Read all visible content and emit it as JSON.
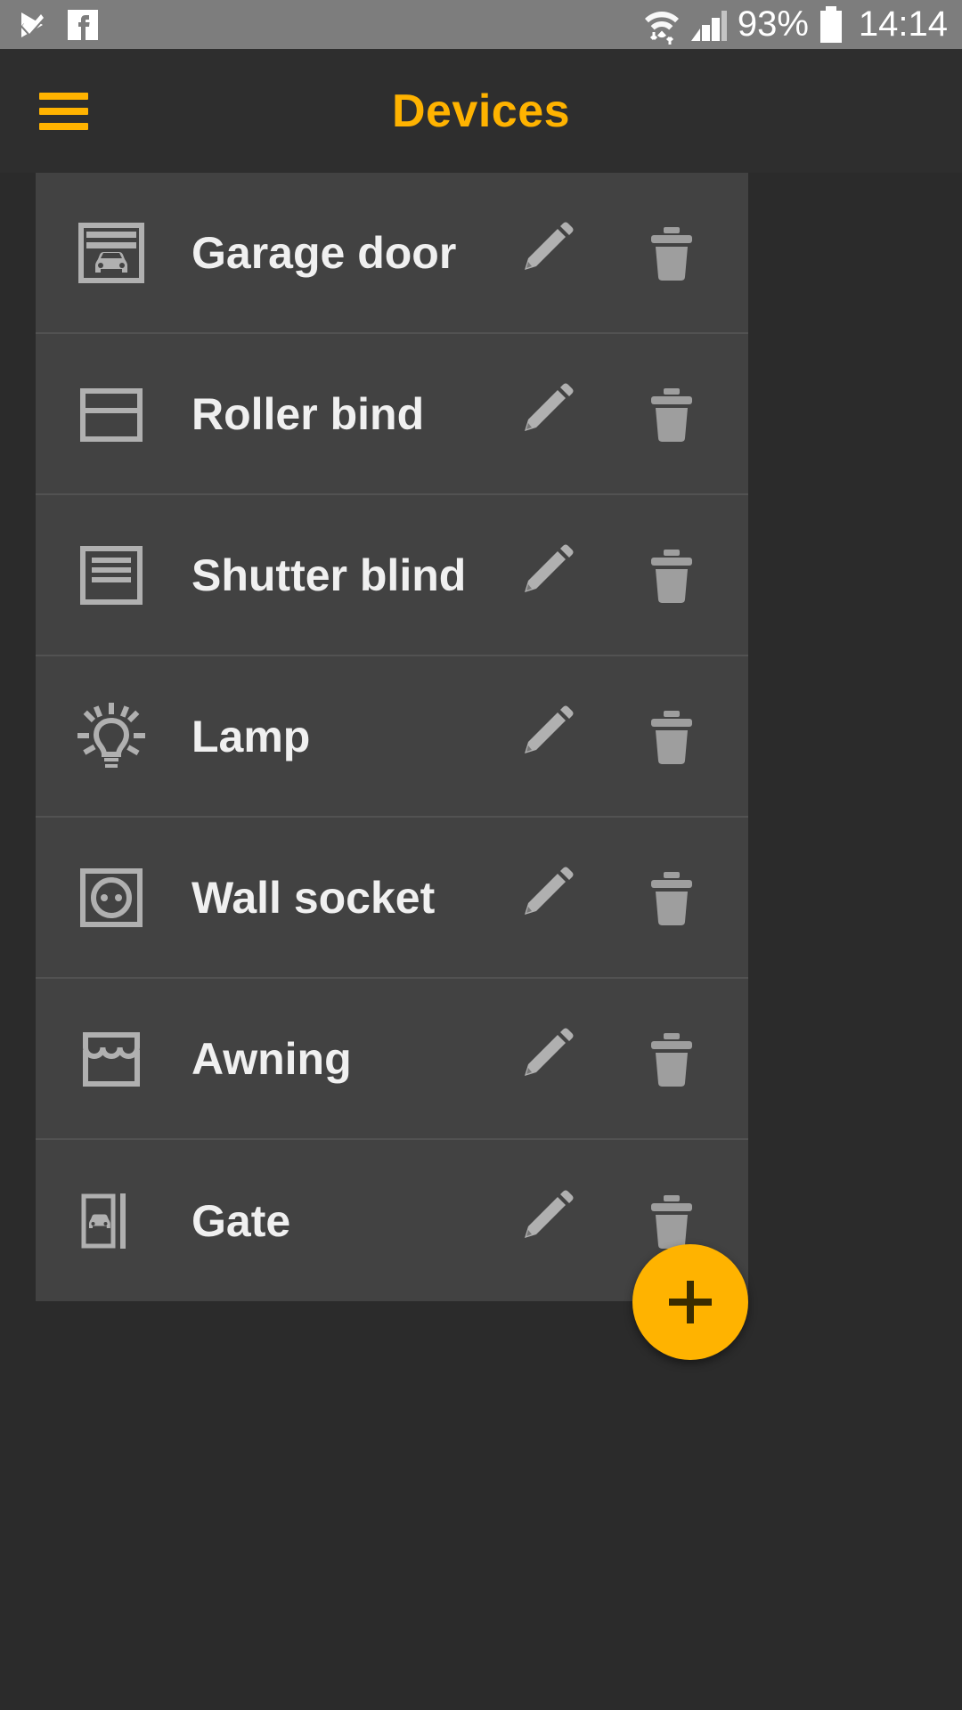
{
  "status_bar": {
    "left_icons": [
      "play-check-icon",
      "facebook-icon"
    ],
    "wifi_icon": "wifi-data-icon",
    "signal_icon": "signal-bars-icon",
    "battery_percent": "93%",
    "battery_icon": "battery-full-icon",
    "clock": "14:14"
  },
  "header": {
    "menu_icon": "hamburger-menu-icon",
    "title": "Devices",
    "accent_color": "#FFB300"
  },
  "devices": [
    {
      "name": "Garage door",
      "icon": "garage-door-icon",
      "edit_label": "edit-icon",
      "delete_label": "trash-icon"
    },
    {
      "name": "Roller bind",
      "icon": "roller-blind-icon",
      "edit_label": "edit-icon",
      "delete_label": "trash-icon"
    },
    {
      "name": "Shutter blind",
      "icon": "shutter-blind-icon",
      "edit_label": "edit-icon",
      "delete_label": "trash-icon"
    },
    {
      "name": "Lamp",
      "icon": "lamp-icon",
      "edit_label": "edit-icon",
      "delete_label": "trash-icon"
    },
    {
      "name": "Wall socket",
      "icon": "wall-socket-icon",
      "edit_label": "edit-icon",
      "delete_label": "trash-icon"
    },
    {
      "name": "Awning",
      "icon": "awning-icon",
      "edit_label": "edit-icon",
      "delete_label": "trash-icon"
    },
    {
      "name": "Gate",
      "icon": "gate-icon",
      "edit_label": "edit-icon",
      "delete_label": "trash-icon"
    }
  ],
  "fab": {
    "icon": "plus-icon",
    "color": "#FFB300"
  }
}
